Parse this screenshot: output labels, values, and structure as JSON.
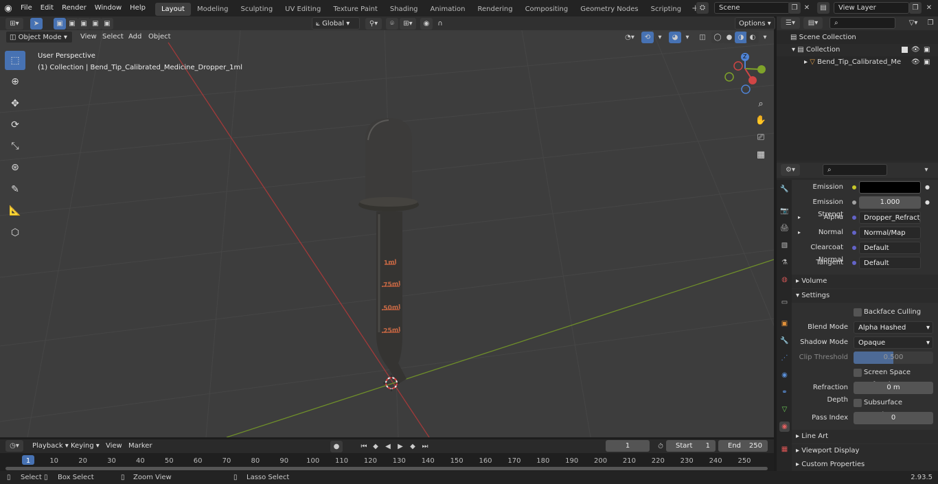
{
  "menu": {
    "file": "File",
    "edit": "Edit",
    "render": "Render",
    "window": "Window",
    "help": "Help"
  },
  "workspaces": [
    "Layout",
    "Modeling",
    "Sculpting",
    "UV Editing",
    "Texture Paint",
    "Shading",
    "Animation",
    "Rendering",
    "Compositing",
    "Geometry Nodes",
    "Scripting"
  ],
  "active_workspace": "Layout",
  "scene": {
    "name": "Scene",
    "view_layer": "View Layer"
  },
  "viewport_header": {
    "mode": "Object Mode",
    "view": "View",
    "select": "Select",
    "add": "Add",
    "object": "Object",
    "orientation": "Global",
    "options": "Options"
  },
  "viewport": {
    "perspective": "User Perspective",
    "collection_info": "(1) Collection | Bend_Tip_Calibrated_Medicine_Dropper_1ml",
    "markings": [
      "1ml",
      ".75ml",
      ".50ml",
      ".25ml"
    ],
    "axis_labels": {
      "z": "Z",
      "y": "Y",
      "x": "X"
    }
  },
  "outliner": {
    "scene_collection": "Scene Collection",
    "collection": "Collection",
    "object": "Bend_Tip_Calibrated_Me"
  },
  "properties": {
    "rows": [
      {
        "label": "Emission",
        "value": "",
        "kind": "black",
        "socket": "#c7c729"
      },
      {
        "label": "Emission Strengt",
        "value": "1.000",
        "kind": "num",
        "socket": "#a1a1a1"
      },
      {
        "label": "Alpha",
        "value": "Dropper_Refract_inv...",
        "kind": "dark",
        "socket": "#6363c7",
        "expand": true
      },
      {
        "label": "Normal",
        "value": "Normal/Map",
        "kind": "dark",
        "socket": "#6363c7",
        "expand": true
      },
      {
        "label": "Clearcoat Normal",
        "value": "Default",
        "kind": "dark",
        "socket": "#6363c7"
      },
      {
        "label": "Tangent",
        "value": "Default",
        "kind": "dark",
        "socket": "#6363c7"
      }
    ],
    "volume": "Volume",
    "settings": "Settings",
    "backface_culling": "Backface Culling",
    "blend_mode_label": "Blend Mode",
    "blend_mode": "Alpha Hashed",
    "shadow_mode_label": "Shadow Mode",
    "shadow_mode": "Opaque",
    "clip_threshold_label": "Clip Threshold",
    "clip_threshold": "0.500",
    "clip_threshold_fraction": 0.5,
    "ssr": "Screen Space Refraction",
    "refraction_depth_label": "Refraction Depth",
    "refraction_depth": "0 m",
    "subsurface": "Subsurface Translucency",
    "pass_index_label": "Pass Index",
    "pass_index": "0",
    "line_art": "Line Art",
    "viewport_display": "Viewport Display",
    "custom_properties": "Custom Properties"
  },
  "timeline": {
    "playback": "Playback",
    "keying": "Keying",
    "view": "View",
    "marker": "Marker",
    "current_frame": "1",
    "start_label": "Start",
    "start": "1",
    "end_label": "End",
    "end": "250",
    "ticks": [
      "1",
      "10",
      "20",
      "30",
      "40",
      "50",
      "60",
      "70",
      "80",
      "90",
      "100",
      "110",
      "120",
      "130",
      "140",
      "150",
      "160",
      "170",
      "180",
      "190",
      "200",
      "210",
      "220",
      "230",
      "240",
      "250"
    ]
  },
  "statusbar": {
    "select": "Select",
    "box_select": "Box Select",
    "zoom_view": "Zoom View",
    "lasso_select": "Lasso Select",
    "version": "2.93.5"
  }
}
